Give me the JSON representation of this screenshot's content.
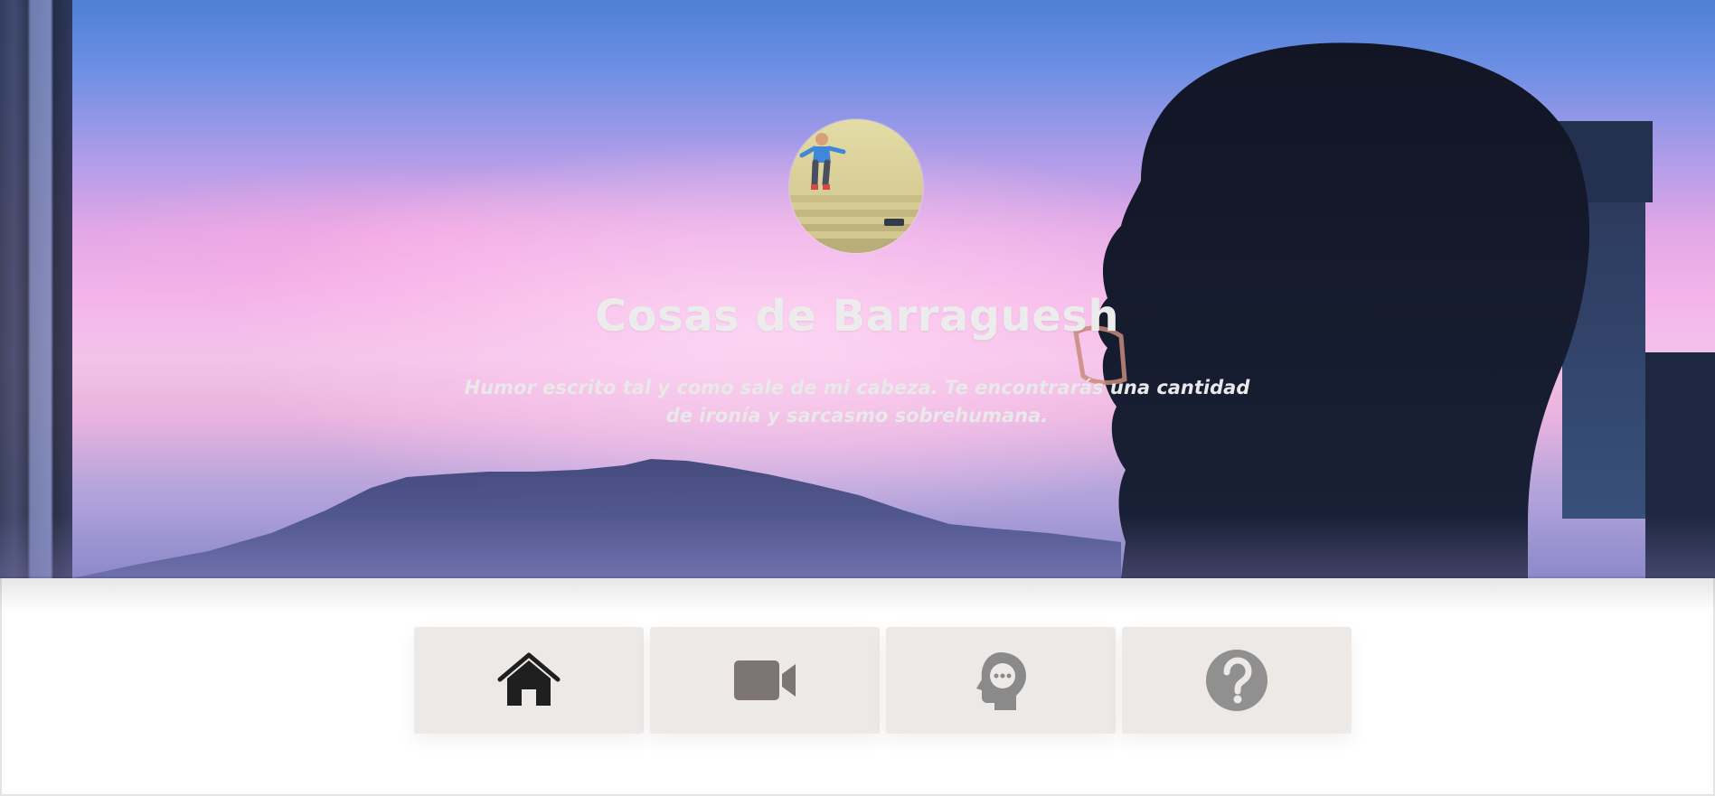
{
  "site": {
    "title": "Cosas de Barraguesh",
    "subtitle": "Humor escrito tal y como sale de mi cabeza. Te encontrarás una cantidad de ironía y sarcasmo sobrehumana."
  },
  "avatar": {
    "icon": "avatar-jumping-person"
  },
  "nav": {
    "items": [
      {
        "icon": "home-icon",
        "color": "#1f1f1f",
        "active": true
      },
      {
        "icon": "video-camera-icon",
        "color": "#7d7575",
        "active": false
      },
      {
        "icon": "thinking-head-icon",
        "color": "#8a8a8a",
        "active": false
      },
      {
        "icon": "question-circle-icon",
        "color": "#909090",
        "active": false
      }
    ]
  },
  "colors": {
    "nav_background": "#ece9e7",
    "title_text": "#ececec",
    "page_background": "#ffffff"
  }
}
